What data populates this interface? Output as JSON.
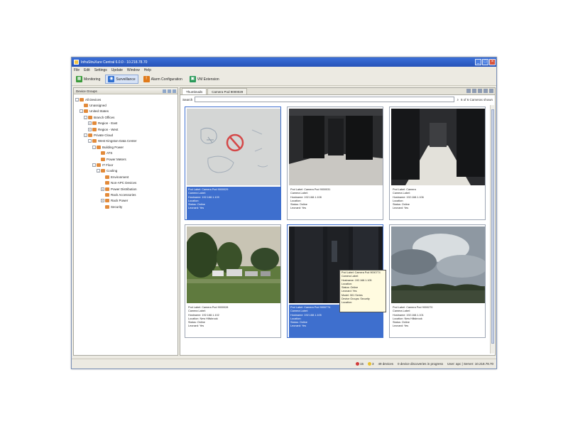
{
  "window": {
    "title": "InfraStruXure Central 6.0.0 - 10.218.78.70"
  },
  "menu": [
    "File",
    "Edit",
    "Settings",
    "Update",
    "Window",
    "Help"
  ],
  "perspectives": [
    {
      "label": "Monitoring",
      "icon": "monitoring-icon",
      "color": "#3a9a3a"
    },
    {
      "label": "Surveillance",
      "icon": "camera-icon",
      "color": "#2f6fd0"
    },
    {
      "label": "Alarm Configuration",
      "icon": "alarm-icon",
      "color": "#e07a1a"
    },
    {
      "label": "VM Extension",
      "icon": "vm-icon",
      "color": "#2a9a5a"
    }
  ],
  "device_groups": {
    "header": "Device Groups",
    "tree": [
      {
        "label": "All Devices",
        "toggle": "-"
      },
      {
        "label": "Unassigned",
        "toggle": ""
      },
      {
        "label": "United States",
        "toggle": "-"
      },
      {
        "label": "Branch Offices",
        "toggle": "-"
      },
      {
        "label": "Region - East",
        "toggle": "+"
      },
      {
        "label": "Region - West",
        "toggle": "+"
      },
      {
        "label": "Private Cloud",
        "toggle": "-"
      },
      {
        "label": "West Kingston Data Center",
        "toggle": "-"
      },
      {
        "label": "Building Power",
        "toggle": "-"
      },
      {
        "label": "ATS",
        "toggle": ""
      },
      {
        "label": "Power Meters",
        "toggle": ""
      },
      {
        "label": "IT Floor",
        "toggle": "-"
      },
      {
        "label": "Cooling",
        "toggle": "-"
      },
      {
        "label": "Environment",
        "toggle": ""
      },
      {
        "label": "Non-APC Devices",
        "toggle": ""
      },
      {
        "label": "Power Distribution",
        "toggle": "+"
      },
      {
        "label": "Rack Accessories",
        "toggle": ""
      },
      {
        "label": "Rack Power",
        "toggle": "+"
      },
      {
        "label": "Security",
        "toggle": ""
      }
    ]
  },
  "tabs": [
    {
      "label": "Thumbnails"
    },
    {
      "label": "Camera Pod 9000029"
    }
  ],
  "search": {
    "label": "Search",
    "value": "",
    "count": "6 of 6 Cameras shown"
  },
  "cameras": [
    {
      "lines": [
        "Pod Label: Camera Pod 9000029",
        "Camera Label:",
        "Hostname: 192.168.1.109",
        "Location:",
        "Status: Online",
        "Leonard: Yes"
      ],
      "selected": true
    },
    {
      "lines": [
        "Pod Label: Camera Pod 9000031",
        "Camera Label:",
        "Hostname: 192.168.1.108",
        "Location:",
        "Status: Online",
        "Leonard: Yes"
      ],
      "selected": false
    },
    {
      "lines": [
        "Pod Label: Camera",
        "Camera Label:",
        "Hostname: 192.168.1.106",
        "Location:",
        "Status: Online",
        "Leonard: Yes"
      ],
      "selected": false
    },
    {
      "lines": [
        "Pod Label: Camera Pod 9000028",
        "Camera Label:",
        "Hostname: 192.168.1.102",
        "Location: New Hillsbrook",
        "Status: Online",
        "Leonard: Yes"
      ],
      "selected": false
    },
    {
      "lines": [
        "Pod Label: Camera Pod 9000774",
        "Camera Label:",
        "Hostname: 192.168.1.105",
        "Location:",
        "Status: Online",
        "Leonard: Yes"
      ],
      "selected": true
    },
    {
      "lines": [
        "Pod Label: Camera Pod 9000270",
        "Camera Label:",
        "Hostname: 192.168.1.101",
        "Location: New Hillsbrook",
        "Status: Online",
        "Leonard: Yes"
      ],
      "selected": false
    }
  ],
  "tooltip": {
    "lines": [
      "Pod Label: Camera Pod 9000774",
      "Camera Label:",
      "Hostname: 192.168.1.105",
      "Location:",
      "Status: Online",
      "Leonard: Yes",
      "Model: 501 Series",
      "Device Groups: Security",
      "Location:"
    ]
  },
  "status": {
    "alarms_red": "15",
    "alarms_yellow": "3",
    "devices": "49 devices",
    "discovery": "0 device discoveries in progress",
    "user": "User: apc | Server: 10.218.78.70"
  }
}
